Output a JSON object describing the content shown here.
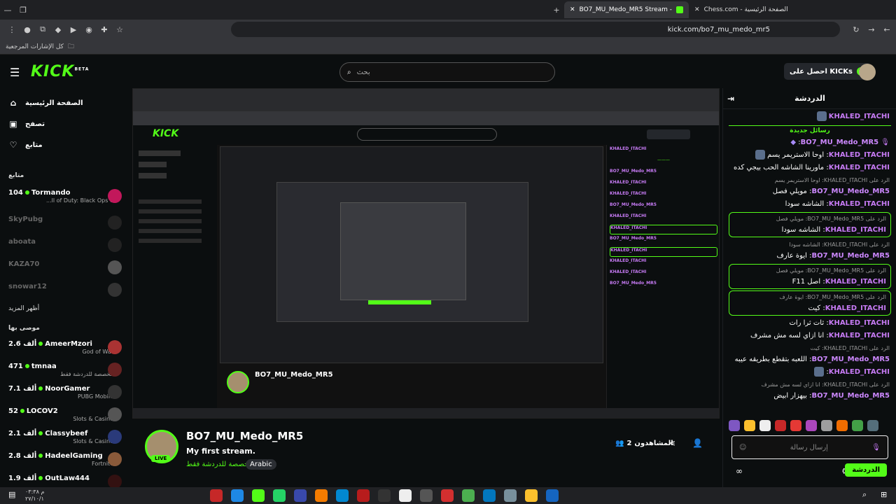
{
  "browser": {
    "tabs": [
      {
        "label": "Chess.com - الصفحة الرئيسية"
      },
      {
        "label": "BO7_MU_Medo_MR5 Stream -"
      }
    ],
    "url": "kick.com/bo7_mu_medo_mr5",
    "bookmarks_label": "كل الإشارات المرجعية"
  },
  "header": {
    "logo": "KICK",
    "logo_beta": "BETA",
    "search_placeholder": "بحث",
    "kicks_label": "احصل على KICKs"
  },
  "sidebar": {
    "nav": [
      {
        "label": "الصفحة الرئيسية",
        "icon": "home-icon"
      },
      {
        "label": "تصفح",
        "icon": "browse-icon"
      },
      {
        "label": "متابع",
        "icon": "heart-icon"
      }
    ],
    "following_title": "متابع",
    "following": [
      {
        "viewers": "104",
        "name": "Tormando",
        "category": "...ll of Duty: Black Ops 6",
        "live": true
      },
      {
        "viewers": "",
        "name": "SkyPubg",
        "category": "",
        "live": false
      },
      {
        "viewers": "",
        "name": "aboata",
        "category": "",
        "live": false
      },
      {
        "viewers": "",
        "name": "KAZA70",
        "category": "",
        "live": false
      },
      {
        "viewers": "",
        "name": "snowar12",
        "category": "",
        "live": false
      }
    ],
    "show_more": "أظهر المزيد",
    "recommended_title": "موصى بها",
    "recommended": [
      {
        "viewers": "2.6 ألف",
        "name": "AmeerMzori",
        "category": "God of War"
      },
      {
        "viewers": "471",
        "name": "tmnaa",
        "category": "مخصصة للدردشة فقط"
      },
      {
        "viewers": "7.1 ألف",
        "name": "NoorGamer",
        "category": "PUBG Mobile"
      },
      {
        "viewers": "52",
        "name": "LOCOV2",
        "category": "Slots & Casino"
      },
      {
        "viewers": "2.1 ألف",
        "name": "Classybeef",
        "category": "Slots & Casino"
      },
      {
        "viewers": "2.8 ألف",
        "name": "HadeelGaming",
        "category": "Fortnite"
      },
      {
        "viewers": "1.9 ألف",
        "name": "OutLaw444",
        "category": ""
      }
    ]
  },
  "stream": {
    "streamer": "BO7_MU_Medo_MR5",
    "title": "My first stream.",
    "category": "مخصصة للدردشة فقط",
    "language": "Arabic",
    "live_badge": "LIVE",
    "viewers": "2",
    "viewers_label": "المشاهدون"
  },
  "chat": {
    "title": "الدردشة",
    "new_messages": "رسائل جديدة",
    "input_placeholder": "إرسال رسالة",
    "send_label": "الدردشة",
    "messages": [
      {
        "user": "KHALED_ITACHI",
        "text": "",
        "reply": ""
      },
      {
        "user": "BO7_MU_Medo_MR5",
        "text": "",
        "reply": ""
      },
      {
        "user": "KHALED_ITACHI",
        "text": "اوحا الاستريمر يسم",
        "reply": ""
      },
      {
        "user": "KHALED_ITACHI",
        "text": "ماورينا الشاشه الحب بيجي كده",
        "reply": ""
      },
      {
        "user": "BO7_MU_Medo_MR5",
        "text": "مويلي فصل",
        "reply": "الرد على KHALED_ITACHI: اوحا الاستريمر يسم"
      },
      {
        "user": "KHALED_ITACHI",
        "text": "الشاشه سودا",
        "reply": ""
      },
      {
        "user": "KHALED_ITACHI",
        "text": "الشاشه سودا",
        "reply": "الرد على BO7_MU_Medo_MR5: مويلي فصل"
      },
      {
        "user": "BO7_MU_Medo_MR5",
        "text": "ايوة عارف",
        "reply": "الرد على KHALED_ITACHI: الشاشه سودا"
      },
      {
        "user": "KHALED_ITACHI",
        "text": "اصل F11",
        "reply": "الرد على BO7_MU_Medo_MR5: مويلي فصل"
      },
      {
        "user": "KHALED_ITACHI",
        "text": "كيت",
        "reply": "الرد على BO7_MU_Medo_MR5: ايوة عارف"
      },
      {
        "user": "KHALED_ITACHI",
        "text": "ثات ثرا رات",
        "reply": ""
      },
      {
        "user": "KHALED_ITACHI",
        "text": "انا ازاي لسه مش مشرف",
        "reply": ""
      },
      {
        "user": "BO7_MU_Medo_MR5",
        "text": "اللعبه بتقطع بطريقه عيبه",
        "reply": "الرد على KHALED_ITACHI: كيت"
      },
      {
        "user": "KHALED_ITACHI",
        "text": "",
        "reply": ""
      },
      {
        "user": "BO7_MU_Medo_MR5",
        "text": "بيهزار ابيض",
        "reply": "الرد على KHALED_ITACHI: انا ازاي لسه مش مشرف"
      }
    ]
  },
  "taskbar": {
    "time": "۰۳:۳۸ م",
    "date": "۲۷/۱۰/۱"
  },
  "colors": {
    "accent": "#53fc18",
    "username": "#c77bf5",
    "background": "#0b0e0f"
  }
}
